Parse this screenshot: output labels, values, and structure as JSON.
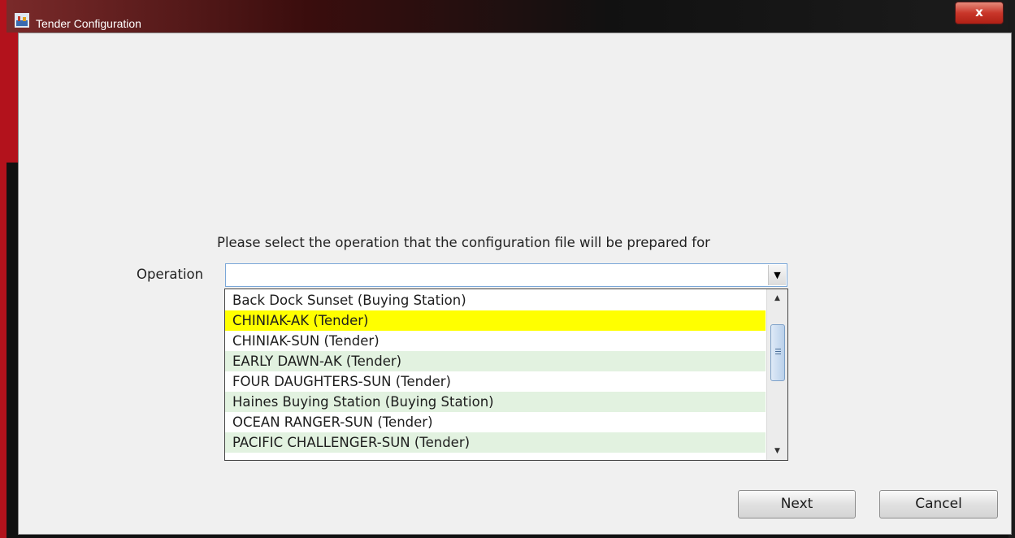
{
  "window": {
    "title": "Tender Configuration",
    "close_glyph": "x"
  },
  "dialog": {
    "instruction": "Please select the operation that the configuration file will be prepared for",
    "operation_label": "Operation",
    "operation_value": "",
    "dropdown_arrow": "▼"
  },
  "options": [
    "Back Dock Sunset (Buying Station)",
    "CHINIAK-AK (Tender)",
    "CHINIAK-SUN (Tender)",
    "EARLY DAWN-AK (Tender)",
    "FOUR DAUGHTERS-SUN (Tender)",
    "Haines Buying Station (Buying Station)",
    "OCEAN RANGER-SUN (Tender)",
    "PACIFIC CHALLENGER-SUN (Tender)"
  ],
  "highlighted_option": "CHINIAK-AK (Tender)",
  "colors": {
    "highlight": "#ffff00",
    "alt_row": "#e2f2e0"
  },
  "scrollbar": {
    "up_arrow": "▲",
    "down_arrow": "▼"
  },
  "buttons": {
    "next": "Next",
    "cancel": "Cancel"
  }
}
